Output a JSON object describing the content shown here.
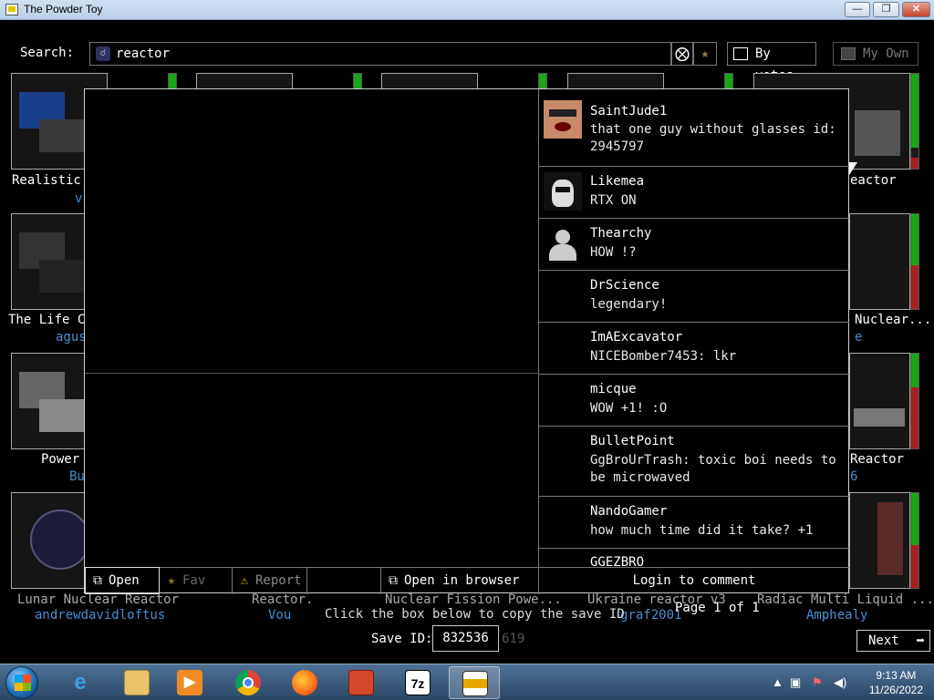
{
  "window": {
    "title": "The Powder Toy",
    "min": "—",
    "max": "❐",
    "close": "✕"
  },
  "search": {
    "label": "Search:",
    "value": "reactor",
    "clear_icon": "⨂",
    "fav_icon": "★"
  },
  "sort": {
    "by_votes": "By votes",
    "my_own": "My Own"
  },
  "saves": [
    {
      "title": "Realistic",
      "author": "v"
    },
    {
      "title": "The Life C",
      "author": "agus"
    },
    {
      "title": "Power",
      "author": "Bu"
    },
    {
      "title": "Lunar Nuclear Reactor",
      "author": "andrewdavidloftus"
    },
    {
      "title": "Reactor.",
      "author": "Vou"
    },
    {
      "title": "Nuclear Fission Powe...",
      "author": ""
    },
    {
      "title": "Ukraine reactor v3",
      "author": "graf2001"
    },
    {
      "title": "Radiac Multi Liquid ...",
      "author": "Amphealy"
    },
    {
      "title": "eactor",
      "author": ""
    },
    {
      "title": "Nuclear...",
      "author": "e"
    },
    {
      "title": "Reactor",
      "author": "6"
    }
  ],
  "votes": [
    {
      "up": 0.95,
      "down": 0
    },
    {
      "up": 1,
      "down": 0
    },
    {
      "up": 1,
      "down": 0
    },
    {
      "up": 1,
      "down": 0
    },
    {
      "up": 1,
      "down": 0
    },
    {
      "up": 0.78,
      "down": 0.12
    },
    {
      "up": 0.54,
      "down": 0.46
    },
    {
      "up": 0.36,
      "down": 0.64
    },
    {
      "up": 0.36,
      "down": 0.64
    },
    {
      "up": 0.55,
      "down": 0.45
    }
  ],
  "comments": [
    {
      "user": "SaintJude1",
      "text": "that one guy without glasses id: 2945797",
      "avatar": "face-photo"
    },
    {
      "user": "Likemea",
      "text": "RTX ON",
      "avatar": "dark-mask"
    },
    {
      "user": "Thearchy",
      "text": "HOW !?",
      "avatar": "default-user"
    },
    {
      "user": "DrScience",
      "text": "legendary!",
      "avatar": ""
    },
    {
      "user": "ImAExcavator",
      "text": "NICEBomber7453: lkr",
      "avatar": ""
    },
    {
      "user": "micque",
      "text": "WOW +1! :O",
      "avatar": ""
    },
    {
      "user": "BulletPoint",
      "text": "GgBroUrTrash: toxic boi needs to be microwaved",
      "avatar": ""
    },
    {
      "user": "NandoGamer",
      "text": "how much time did it take? +1",
      "avatar": ""
    },
    {
      "user": "GGEZBRO",
      "text": "",
      "avatar": ""
    }
  ],
  "actions": {
    "open": "Open",
    "fav": "Fav",
    "report": "Report",
    "open_browser": "Open in browser",
    "login": "Login to comment"
  },
  "footer": {
    "hint_a": "Click the box below to copy the save ID",
    "hint_b": "Page 1 of 1",
    "save_id_label": "Save ID:",
    "save_id": "832536",
    "ghost_id": "619",
    "next": "Next"
  },
  "taskbar": {
    "time": "9:13 AM",
    "date": "11/26/2022",
    "apps": [
      "internet-explorer",
      "file-explorer",
      "media-player",
      "chrome",
      "firefox",
      "red-app",
      "7zip",
      "powder-toy"
    ]
  },
  "colors": {
    "vote_up": "#19a619",
    "vote_down": "#a82020",
    "author": "#4a8ed0"
  }
}
